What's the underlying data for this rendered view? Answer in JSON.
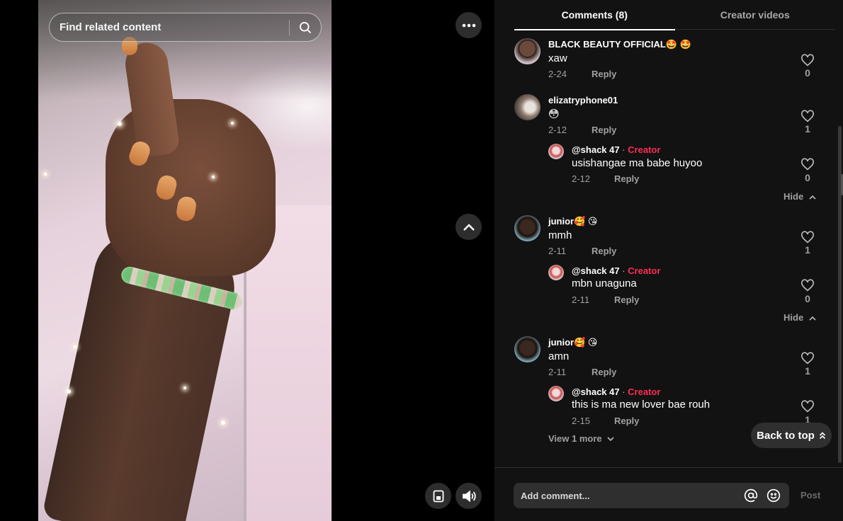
{
  "search": {
    "placeholder": "Find related content"
  },
  "tabs": [
    {
      "label": "Comments (8)",
      "active": true
    },
    {
      "label": "Creator videos",
      "active": false
    }
  ],
  "comments": [
    {
      "user": "BLACK BEAUTY OFFICIAL🤩 🤩",
      "text": "xaw",
      "date": "2-24",
      "reply": "Reply",
      "likes": "0"
    },
    {
      "user": "elizatryphone01",
      "text": "😳",
      "date": "2-12",
      "reply": "Reply",
      "likes": "1",
      "replies": [
        {
          "user": "@shack 47",
          "sep": " · ",
          "tag": "Creator",
          "text": "usishangae ma babe huyoo",
          "date": "2-12",
          "reply": "Reply",
          "likes": "0"
        }
      ],
      "hide": "Hide"
    },
    {
      "user": "junior🥰 😘",
      "text": "mmh",
      "date": "2-11",
      "reply": "Reply",
      "likes": "1",
      "replies": [
        {
          "user": "@shack 47",
          "sep": " · ",
          "tag": "Creator",
          "text": "mbn unaguna",
          "date": "2-11",
          "reply": "Reply",
          "likes": "0"
        }
      ],
      "hide": "Hide"
    },
    {
      "user": "junior🥰 😘",
      "text": "amn",
      "date": "2-11",
      "reply": "Reply",
      "likes": "1",
      "replies": [
        {
          "user": "@shack 47",
          "sep": " · ",
          "tag": "Creator",
          "text": "this is ma new lover bae rouh",
          "date": "2-15",
          "reply": "Reply",
          "likes": "1"
        }
      ],
      "view_more": "View 1 more"
    }
  ],
  "back_to_top": "Back to top",
  "composer": {
    "placeholder": "Add comment...",
    "post": "Post"
  },
  "colors": {
    "panel_bg": "#121212",
    "creator_tag": "#fe2c55",
    "muted": "#a0a0a0"
  },
  "icons": [
    "search-icon",
    "more-icon",
    "chevron-up-icon",
    "mini-player-icon",
    "volume-icon",
    "heart-icon",
    "chevron-down-icon",
    "at-icon",
    "emoji-icon"
  ]
}
